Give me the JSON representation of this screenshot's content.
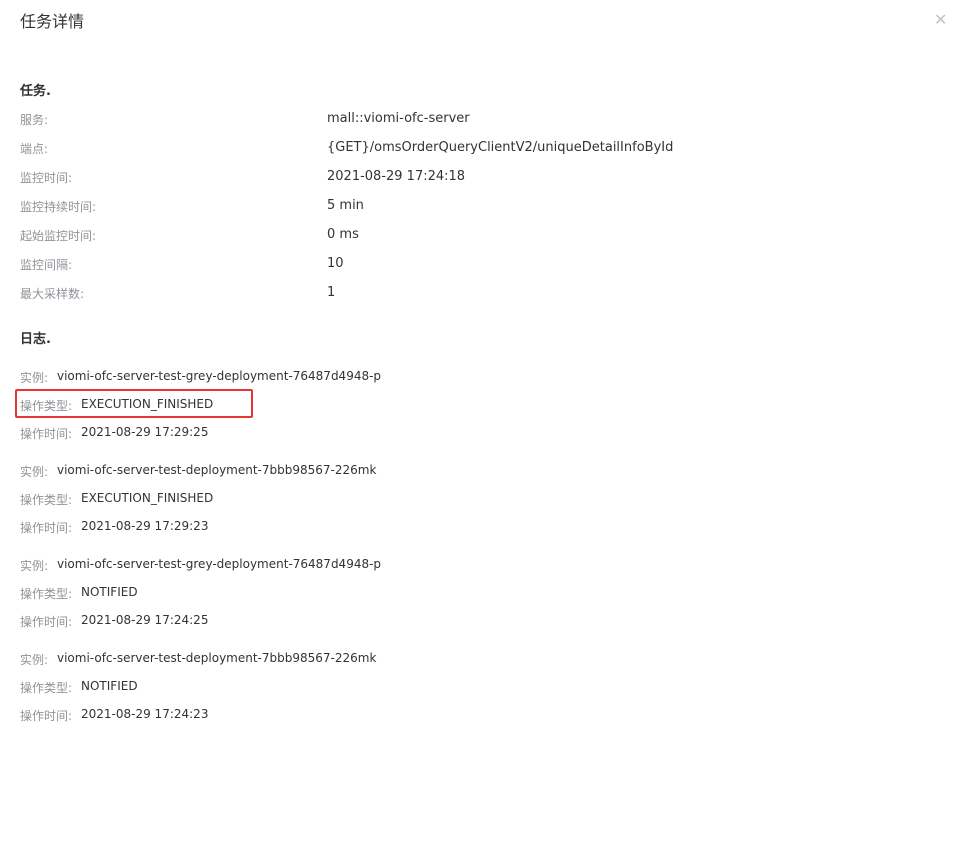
{
  "dialog": {
    "title": "任务详情",
    "close_icon": "close-icon"
  },
  "task": {
    "section_title": "任务.",
    "fields": [
      {
        "label": "服务:",
        "value": "mall::viomi-ofc-server"
      },
      {
        "label": "端点:",
        "value": "{GET}/omsOrderQueryClientV2/uniqueDetailInfoById"
      },
      {
        "label": "监控时间:",
        "value": "2021-08-29 17:24:18"
      },
      {
        "label": "监控持续时间:",
        "value": "5 min"
      },
      {
        "label": "起始监控时间:",
        "value": "0 ms"
      },
      {
        "label": "监控间隔:",
        "value": "10"
      },
      {
        "label": "最大采样数:",
        "value": "1"
      }
    ]
  },
  "logs": {
    "section_title": "日志.",
    "entries": [
      {
        "instance_label": "实例:",
        "instance": "viomi-ofc-server-test-grey-deployment-76487d4948-p",
        "type_label": "操作类型:",
        "type": "EXECUTION_FINISHED",
        "time_label": "操作时间:",
        "time": "2021-08-29 17:29:25"
      },
      {
        "instance_label": "实例:",
        "instance": "viomi-ofc-server-test-deployment-7bbb98567-226mk",
        "type_label": "操作类型:",
        "type": "EXECUTION_FINISHED",
        "time_label": "操作时间:",
        "time": "2021-08-29 17:29:23"
      },
      {
        "instance_label": "实例:",
        "instance": "viomi-ofc-server-test-grey-deployment-76487d4948-p",
        "type_label": "操作类型:",
        "type": "NOTIFIED",
        "time_label": "操作时间:",
        "time": "2021-08-29 17:24:25"
      },
      {
        "instance_label": "实例:",
        "instance": "viomi-ofc-server-test-deployment-7bbb98567-226mk",
        "type_label": "操作类型:",
        "type": "NOTIFIED",
        "time_label": "操作时间:",
        "time": "2021-08-29 17:24:23"
      }
    ]
  },
  "colors": {
    "label": "#909399",
    "value": "#333333",
    "highlight_border": "#e63535"
  }
}
